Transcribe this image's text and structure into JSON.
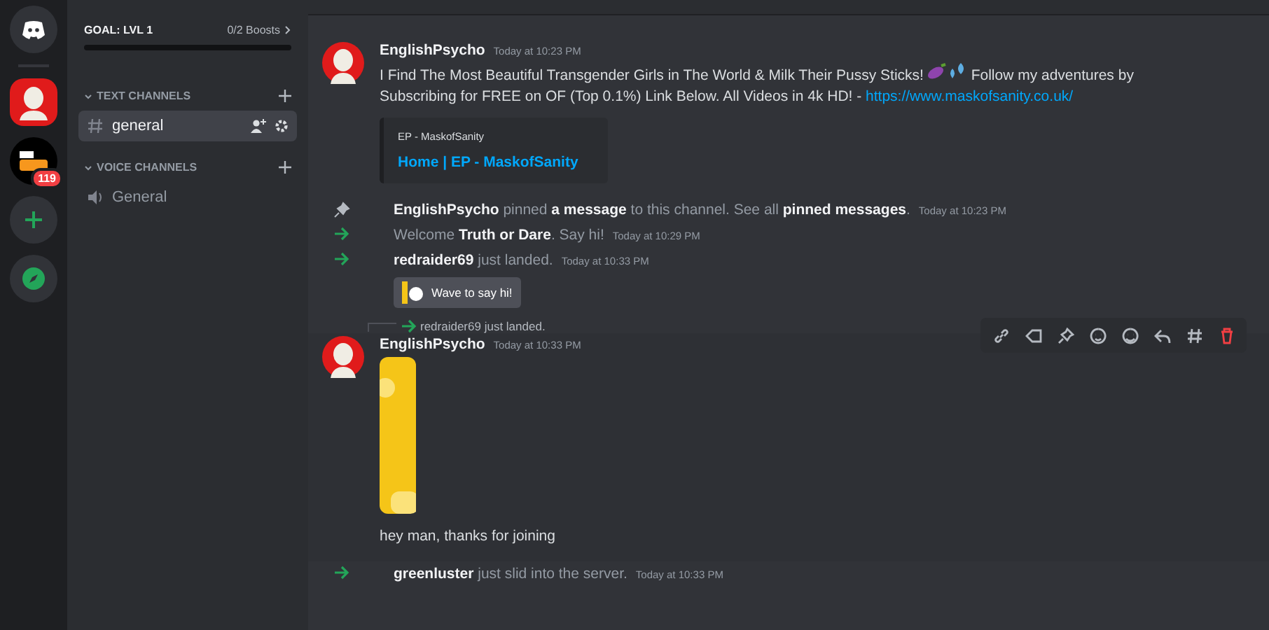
{
  "goal": {
    "title": "GOAL: LVL 1",
    "boosts": "0/2 Boosts",
    "level": 0
  },
  "servers": [
    {
      "kind": "home"
    },
    {
      "kind": "avatar",
      "selected": true
    },
    {
      "kind": "logo",
      "badge": "119"
    },
    {
      "kind": "add"
    },
    {
      "kind": "explore"
    }
  ],
  "categories": [
    {
      "title": "TEXT CHANNELS",
      "channels": [
        {
          "name": "general",
          "kind": "text",
          "selected": true
        }
      ]
    },
    {
      "title": "VOICE CHANNELS",
      "channels": [
        {
          "name": "General",
          "kind": "voice",
          "selected": false
        }
      ]
    }
  ],
  "messages": [
    {
      "kind": "message",
      "author": "EnglishPsycho",
      "time": "Today at 10:23 PM",
      "text": "I Find The Most Beautiful Transgender Girls in The World & Milk Their Pussy Sticks!",
      "emoji": true,
      "text_after": "Follow my adventures by Subscribing for FREE on OF (Top 0.1%) Link Below. All Videos in 4k HD! -",
      "link": "https://www.maskofsanity.co.uk/",
      "embed": {
        "provider": "EP - MaskofSanity",
        "title": "Home | EP - MaskofSanity"
      }
    },
    {
      "kind": "pin",
      "text": "**EnglishPsycho** pinned **a message** to this channel. See all **pinned messages**.",
      "time": "Today at 10:23 PM"
    },
    {
      "kind": "join",
      "text": "Welcome **Truth or Dare**. Say hi!",
      "time": "Today at 10:29 PM"
    },
    {
      "kind": "join",
      "text": "**redraider69** just landed.",
      "time": "Today at 10:33 PM",
      "wave": "Wave to say hi!"
    },
    {
      "kind": "message",
      "author": "EnglishPsycho",
      "time": "Today at 10:33 PM",
      "reply": "redraider69 just landed.",
      "image": true,
      "hovered": true,
      "text": "hey man, thanks for joining"
    },
    {
      "kind": "join",
      "text": "**greenluster** just slid into the server.",
      "time": "Today at 10:33 PM"
    }
  ]
}
